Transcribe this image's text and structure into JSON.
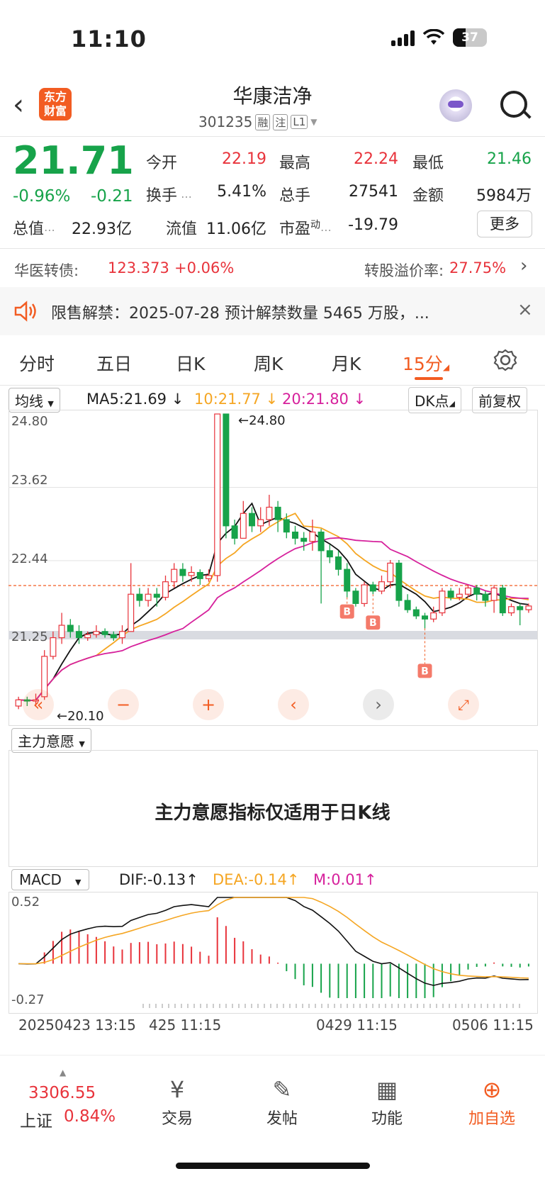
{
  "status": {
    "time": "11:10",
    "battery": "37"
  },
  "header": {
    "logo_line1": "东方",
    "logo_line2": "财富",
    "name": "华康洁净",
    "code": "301235",
    "tags": [
      "融",
      "注",
      "L1"
    ]
  },
  "quote": {
    "price": "21.71",
    "change_pct": "-0.96%",
    "change": "-0.21",
    "open_label": "今开",
    "open": "22.19",
    "high_label": "最高",
    "high": "22.24",
    "low_label": "最低",
    "low": "21.46",
    "turnover_label": "换手",
    "turnover": "5.41%",
    "volume_label": "总手",
    "volume": "27541",
    "amount_label": "金额",
    "amount": "5984万",
    "mktcap_label": "总值",
    "mktcap": "22.93亿",
    "float_label": "流值",
    "float": "11.06亿",
    "pe_label": "市盈",
    "pe_sup": "动",
    "pe": "-19.79",
    "more": "更多"
  },
  "bond": {
    "label": "华医转债:",
    "price": "123.373",
    "change": "+0.06%",
    "premium_label": "转股溢价率:",
    "premium": "27.75%"
  },
  "notice": {
    "text": "限售解禁：2025-07-28 预计解禁数量 5465 万股，..."
  },
  "tabs": [
    "分时",
    "五日",
    "日K",
    "周K",
    "月K",
    "15分"
  ],
  "chart": {
    "indicator": "均线",
    "ma5": "MA5:21.69",
    "ma10": "10:21.77",
    "ma20": "20:21.80",
    "dk": "DK点",
    "fq": "前复权",
    "y_labels": [
      "24.80",
      "23.62",
      "22.44",
      "21.25",
      "20.10"
    ],
    "high_mark": "24.80",
    "low_mark": "20.10",
    "signal": "B",
    "colors": {
      "up": "#e8333b",
      "down": "#17a34a",
      "ma5": "#111111",
      "ma10": "#f5a623",
      "ma20": "#d6219c",
      "accent": "#f25c22"
    }
  },
  "mid_panel": {
    "indicator": "主力意愿",
    "message": "主力意愿指标仅适用于日K线"
  },
  "macd": {
    "indicator": "MACD",
    "dif": "DIF:-0.13",
    "dea": "DEA:-0.14",
    "m": "M:0.01",
    "y_top": "0.52",
    "y_bottom": "-0.27"
  },
  "time_axis": [
    "20250423 13:15",
    "425 11:15",
    "0429 11:15",
    "0506 11:15"
  ],
  "nav": {
    "index_value": "3306.55",
    "index_name": "上证",
    "index_change": "0.84%",
    "items": [
      {
        "label": "交易",
        "icon": "trade-icon"
      },
      {
        "label": "发帖",
        "icon": "post-icon"
      },
      {
        "label": "功能",
        "icon": "function-icon"
      },
      {
        "label": "加自选",
        "icon": "add-watchlist-icon"
      }
    ]
  },
  "chart_data": {
    "type": "candlestick",
    "ylim": [
      20.1,
      24.8
    ],
    "candles": [
      [
        20.1,
        20.2,
        20.05,
        20.25
      ],
      [
        20.2,
        20.18,
        20.1,
        20.25
      ],
      [
        20.18,
        20.2,
        20.1,
        20.3
      ],
      [
        20.25,
        20.9,
        20.2,
        21.0
      ],
      [
        20.9,
        21.2,
        20.85,
        21.3
      ],
      [
        21.2,
        21.4,
        21.1,
        21.6
      ],
      [
        21.4,
        21.3,
        21.2,
        21.5
      ],
      [
        21.3,
        21.2,
        21.1,
        21.4
      ],
      [
        21.2,
        21.25,
        21.15,
        21.3
      ],
      [
        21.25,
        21.3,
        21.2,
        21.4
      ],
      [
        21.3,
        21.25,
        21.2,
        21.35
      ],
      [
        21.25,
        21.2,
        21.15,
        21.3
      ],
      [
        21.2,
        21.3,
        21.1,
        21.4
      ],
      [
        21.3,
        21.9,
        21.3,
        22.4
      ],
      [
        21.9,
        21.8,
        21.7,
        22.0
      ],
      [
        21.8,
        21.9,
        21.7,
        22.0
      ],
      [
        21.9,
        21.85,
        21.7,
        22.0
      ],
      [
        21.85,
        22.1,
        21.8,
        22.2
      ],
      [
        22.1,
        22.3,
        22.0,
        22.4
      ],
      [
        22.3,
        22.2,
        22.1,
        22.4
      ],
      [
        22.2,
        22.25,
        22.1,
        22.35
      ],
      [
        22.25,
        22.15,
        22.05,
        22.3
      ],
      [
        22.15,
        22.2,
        22.1,
        22.3
      ],
      [
        22.2,
        24.8,
        22.1,
        24.8
      ],
      [
        24.8,
        23.0,
        22.8,
        24.8
      ],
      [
        23.0,
        22.8,
        22.7,
        23.1
      ],
      [
        22.8,
        23.2,
        22.8,
        23.4
      ],
      [
        23.2,
        23.0,
        22.9,
        23.3
      ],
      [
        23.0,
        23.1,
        22.9,
        23.3
      ],
      [
        23.1,
        23.3,
        23.0,
        23.5
      ],
      [
        23.3,
        23.1,
        22.9,
        23.4
      ],
      [
        23.1,
        22.9,
        22.8,
        23.2
      ],
      [
        22.9,
        22.8,
        22.7,
        23.0
      ],
      [
        22.8,
        22.75,
        22.6,
        22.9
      ],
      [
        22.75,
        22.9,
        22.6,
        23.1
      ],
      [
        22.9,
        22.6,
        21.75,
        22.95
      ],
      [
        22.6,
        22.5,
        22.4,
        22.7
      ],
      [
        22.5,
        22.3,
        22.2,
        22.6
      ],
      [
        22.3,
        21.95,
        21.85,
        22.4
      ],
      [
        21.95,
        21.75,
        21.7,
        22.0
      ],
      [
        21.75,
        22.05,
        21.7,
        22.1
      ],
      [
        22.05,
        21.95,
        21.9,
        22.1
      ],
      [
        21.95,
        22.1,
        21.9,
        22.2
      ],
      [
        22.1,
        22.4,
        22.0,
        22.45
      ],
      [
        22.4,
        21.8,
        21.7,
        22.45
      ],
      [
        21.8,
        21.65,
        21.6,
        21.9
      ],
      [
        21.65,
        21.55,
        21.5,
        21.7
      ],
      [
        21.55,
        21.5,
        21.35,
        21.6
      ],
      [
        21.5,
        21.6,
        21.45,
        21.7
      ],
      [
        21.6,
        21.95,
        21.55,
        22.0
      ],
      [
        21.95,
        21.85,
        21.8,
        22.0
      ],
      [
        21.85,
        21.9,
        21.8,
        22.0
      ],
      [
        21.9,
        22.0,
        21.85,
        22.05
      ],
      [
        22.0,
        21.9,
        21.8,
        22.05
      ],
      [
        21.9,
        21.8,
        21.7,
        21.95
      ],
      [
        21.8,
        22.0,
        21.6,
        22.05
      ],
      [
        22.0,
        21.6,
        21.55,
        22.05
      ],
      [
        21.6,
        21.7,
        21.55,
        21.75
      ],
      [
        21.7,
        21.65,
        21.4,
        21.75
      ],
      [
        21.65,
        21.71,
        21.6,
        21.75
      ]
    ],
    "buy_signals": [
      38,
      41,
      47
    ],
    "macd": {
      "ylim": [
        -0.27,
        0.52
      ]
    }
  }
}
